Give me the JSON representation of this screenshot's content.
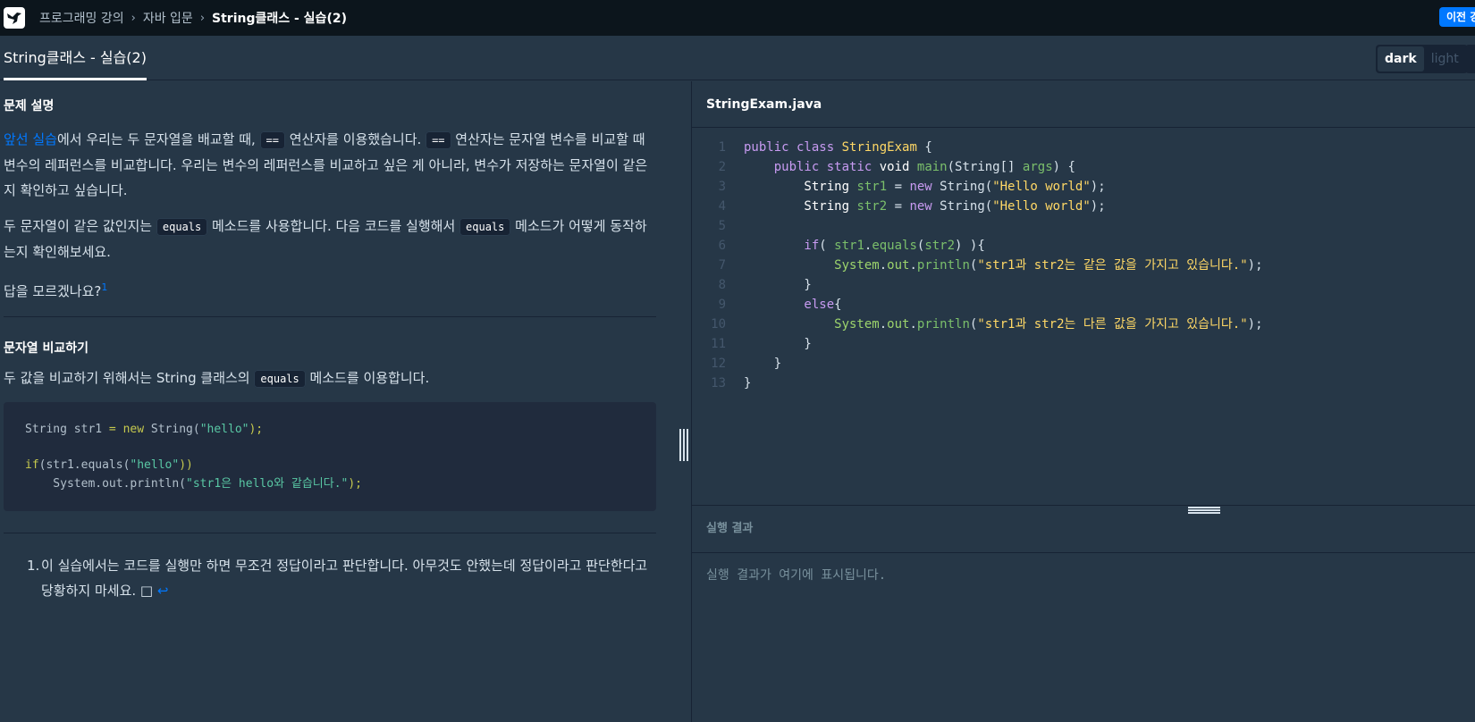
{
  "nav": {
    "breadcrumbs": [
      "프로그래밍 강의",
      "자바 입문",
      "String클래스 - 실습(2)"
    ],
    "prev_button": "이전 강"
  },
  "tab": {
    "title": "String클래스 - 실습(2)"
  },
  "theme": {
    "dark": "dark",
    "light": "light"
  },
  "problem": {
    "section1_title": "문제 설명",
    "p1_link": "앞선 실습",
    "p1_a": "에서 우리는 두 문자열을 배교할 때, ",
    "p1_code1": "==",
    "p1_b": " 연산자를 이용했습니다. ",
    "p1_code2": "==",
    "p1_c": " 연산자는 문자열 변수를 비교할 때 변수의 레퍼런스를 비교합니다. 우리는 변수의 레퍼런스를 비교하고 싶은 게 아니라, 변수가 저장하는 문자열이 같은지 확인하고 싶습니다.",
    "p2_a": "두 문자열이 같은 값인지는 ",
    "p2_code1": "equals",
    "p2_b": " 메소드를 사용합니다. 다음 코드를 실행해서 ",
    "p2_code2": "equals",
    "p2_c": " 메소드가 어떻게 동작하는지 확인해보세요.",
    "p3": "답을 모르겠나요?",
    "p3_fn": "1",
    "section2_title": "문자열 비교하기",
    "p4_a": "두 값을 비교하기 위해서는 String 클래스의 ",
    "p4_code": "equals",
    "p4_b": " 메소드를 이용합니다.",
    "code_sample": {
      "l1_a": "String str1 ",
      "l1_b": "= new",
      "l1_c": " String(",
      "l1_d": "\"hello\"",
      "l1_e": ");",
      "l2_a": "if",
      "l2_b": "(str1.equals(",
      "l2_c": "\"hello\"",
      "l2_d": "))",
      "l3_a": "    System.out.println(",
      "l3_b": "\"str1은 hello와 같습니다.\"",
      "l3_c": ");"
    },
    "footnote_num": "1.",
    "footnote_text": "이 실습에서는 코드를 실행만 하면 무조건 정답이라고 판단합니다. 아무것도 안했는데 정답이라고 판단한다고 당황하지 마세요. □ ",
    "footnote_back": "↩"
  },
  "editor": {
    "filename": "StringExam.java",
    "line_numbers": [
      "1",
      "2",
      "3",
      "4",
      "5",
      "6",
      "7",
      "8",
      "9",
      "10",
      "11",
      "12",
      "13"
    ],
    "l1": {
      "kw1": "public",
      "kw2": " class ",
      "cls": "StringExam",
      "rest": " {"
    },
    "l2": {
      "kw1": "    public",
      "kw2": " static",
      "type": " void ",
      "fn": "main",
      "a": "(String[] ",
      "var": "args",
      "b": ") {"
    },
    "l3": {
      "type": "        String ",
      "var": "str1",
      "a": " = ",
      "kw": "new",
      "b": " String(",
      "str": "\"Hello world\"",
      "c": ");"
    },
    "l4": {
      "type": "        String ",
      "var": "str2",
      "a": " = ",
      "kw": "new",
      "b": " String(",
      "str": "\"Hello world\"",
      "c": ");"
    },
    "l6": {
      "kw": "        if",
      "a": "( ",
      "var": "str1",
      "b": ".",
      "fn": "equals",
      "c": "(",
      "var2": "str2",
      "d": ") ){"
    },
    "l7": {
      "obj": "            System",
      "a": ".",
      "obj2": "out",
      "b": ".",
      "fn": "println",
      "c": "(",
      "str": "\"str1과 str2는 같은 값을 가지고 있습니다.\"",
      "d": ");"
    },
    "l8": {
      "a": "        }"
    },
    "l9": {
      "kw": "        else",
      "a": "{"
    },
    "l10": {
      "obj": "            System",
      "a": ".",
      "obj2": "out",
      "b": ".",
      "fn": "println",
      "c": "(",
      "str": "\"str1과 str2는 다른 값을 가지고 있습니다.\"",
      "d": ");"
    },
    "l11": {
      "a": "        }"
    },
    "l12": {
      "a": "    }"
    },
    "l13": {
      "a": "}"
    }
  },
  "result": {
    "title": "실행 결과",
    "placeholder": "실행 결과가 여기에 표시됩니다."
  }
}
